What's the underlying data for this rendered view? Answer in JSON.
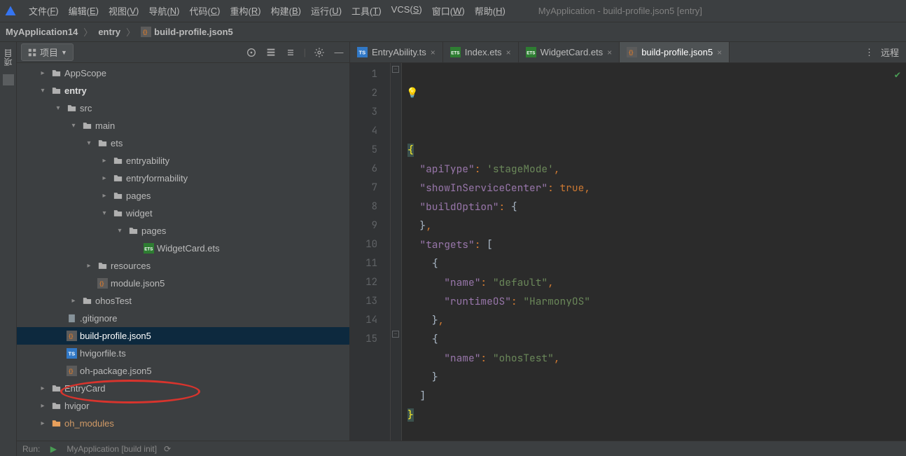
{
  "menubar": {
    "items": [
      {
        "label": "文件(F)"
      },
      {
        "label": "编辑(E)"
      },
      {
        "label": "视图(V)"
      },
      {
        "label": "导航(N)"
      },
      {
        "label": "代码(C)"
      },
      {
        "label": "重构(R)"
      },
      {
        "label": "构建(B)"
      },
      {
        "label": "运行(U)"
      },
      {
        "label": "工具(T)"
      },
      {
        "label": "VCS(S)"
      },
      {
        "label": "窗口(W)"
      },
      {
        "label": "帮助(H)"
      }
    ],
    "window_title": "MyApplication - build-profile.json5 [entry]"
  },
  "breadcrumbs": [
    {
      "label": "MyApplication14"
    },
    {
      "label": "entry"
    },
    {
      "label": "build-profile.json5",
      "icon": "json-file"
    }
  ],
  "left_strip": {
    "label": "项目"
  },
  "panel": {
    "dropdown_label": "项目",
    "tree": [
      {
        "depth": 0,
        "arrow": "right",
        "icon": "folder",
        "label": "AppScope"
      },
      {
        "depth": 0,
        "arrow": "down",
        "icon": "folder",
        "label": "entry",
        "bold": true
      },
      {
        "depth": 1,
        "arrow": "down",
        "icon": "folder",
        "label": "src"
      },
      {
        "depth": 2,
        "arrow": "down",
        "icon": "folder",
        "label": "main"
      },
      {
        "depth": 3,
        "arrow": "down",
        "icon": "folder",
        "label": "ets"
      },
      {
        "depth": 4,
        "arrow": "right",
        "icon": "folder",
        "label": "entryability"
      },
      {
        "depth": 4,
        "arrow": "right",
        "icon": "folder",
        "label": "entryformability"
      },
      {
        "depth": 4,
        "arrow": "right",
        "icon": "folder",
        "label": "pages"
      },
      {
        "depth": 4,
        "arrow": "down",
        "icon": "folder",
        "label": "widget"
      },
      {
        "depth": 5,
        "arrow": "down",
        "icon": "folder",
        "label": "pages"
      },
      {
        "depth": 6,
        "arrow": "",
        "icon": "ets-file",
        "label": "WidgetCard.ets"
      },
      {
        "depth": 3,
        "arrow": "right",
        "icon": "folder",
        "label": "resources"
      },
      {
        "depth": 3,
        "arrow": "",
        "icon": "json-file",
        "label": "module.json5"
      },
      {
        "depth": 2,
        "arrow": "right",
        "icon": "folder",
        "label": "ohosTest"
      },
      {
        "depth": 1,
        "arrow": "",
        "icon": "file",
        "label": ".gitignore"
      },
      {
        "depth": 1,
        "arrow": "",
        "icon": "json-file",
        "label": "build-profile.json5",
        "selected": true
      },
      {
        "depth": 1,
        "arrow": "",
        "icon": "ts-file",
        "label": "hvigorfile.ts"
      },
      {
        "depth": 1,
        "arrow": "",
        "icon": "json-file",
        "label": "oh-package.json5"
      },
      {
        "depth": 0,
        "arrow": "right",
        "icon": "folder",
        "label": "EntryCard"
      },
      {
        "depth": 0,
        "arrow": "right",
        "icon": "folder",
        "label": "hvigor"
      },
      {
        "depth": 0,
        "arrow": "right",
        "icon": "folder-highlight",
        "label": "oh_modules",
        "orange": true
      }
    ]
  },
  "tabs": [
    {
      "label": "EntryAbility.ts",
      "icon": "ts-file"
    },
    {
      "label": "Index.ets",
      "icon": "ets-file"
    },
    {
      "label": "WidgetCard.ets",
      "icon": "ets-file"
    },
    {
      "label": "build-profile.json5",
      "icon": "json-file",
      "active": true
    }
  ],
  "tab_right_label": "远程",
  "code": {
    "line_count": 15,
    "lines": [
      [
        {
          "t": "brace-hl",
          "v": "{"
        }
      ],
      [
        {
          "t": "sp",
          "v": "  "
        },
        {
          "t": "key",
          "v": "\"apiType\""
        },
        {
          "t": "punc",
          "v": ": "
        },
        {
          "t": "str",
          "v": "'stageMode'"
        },
        {
          "t": "punc",
          "v": ","
        }
      ],
      [
        {
          "t": "sp",
          "v": "  "
        },
        {
          "t": "key",
          "v": "\"showInServiceCenter\""
        },
        {
          "t": "punc",
          "v": ": "
        },
        {
          "t": "bool",
          "v": "true"
        },
        {
          "t": "punc",
          "v": ","
        }
      ],
      [
        {
          "t": "sp",
          "v": "  "
        },
        {
          "t": "key",
          "v": "\"buildOption\""
        },
        {
          "t": "punc",
          "v": ": "
        },
        {
          "t": "brace",
          "v": "{"
        }
      ],
      [
        {
          "t": "sp",
          "v": "  "
        },
        {
          "t": "brace",
          "v": "}"
        },
        {
          "t": "punc",
          "v": ","
        }
      ],
      [
        {
          "t": "sp",
          "v": "  "
        },
        {
          "t": "key",
          "v": "\"targets\""
        },
        {
          "t": "punc",
          "v": ": "
        },
        {
          "t": "brace",
          "v": "["
        }
      ],
      [
        {
          "t": "sp",
          "v": "    "
        },
        {
          "t": "brace",
          "v": "{"
        }
      ],
      [
        {
          "t": "sp",
          "v": "      "
        },
        {
          "t": "key",
          "v": "\"name\""
        },
        {
          "t": "punc",
          "v": ": "
        },
        {
          "t": "str",
          "v": "\"default\""
        },
        {
          "t": "punc",
          "v": ","
        }
      ],
      [
        {
          "t": "sp",
          "v": "      "
        },
        {
          "t": "key",
          "v": "\"runtimeOS\""
        },
        {
          "t": "punc",
          "v": ": "
        },
        {
          "t": "str",
          "v": "\"HarmonyOS\""
        }
      ],
      [
        {
          "t": "sp",
          "v": "    "
        },
        {
          "t": "brace",
          "v": "}"
        },
        {
          "t": "punc",
          "v": ","
        }
      ],
      [
        {
          "t": "sp",
          "v": "    "
        },
        {
          "t": "brace",
          "v": "{"
        }
      ],
      [
        {
          "t": "sp",
          "v": "      "
        },
        {
          "t": "key",
          "v": "\"name\""
        },
        {
          "t": "punc",
          "v": ": "
        },
        {
          "t": "str",
          "v": "\"ohosTest\""
        },
        {
          "t": "punc",
          "v": ","
        }
      ],
      [
        {
          "t": "sp",
          "v": "    "
        },
        {
          "t": "brace",
          "v": "}"
        }
      ],
      [
        {
          "t": "sp",
          "v": "  "
        },
        {
          "t": "brace",
          "v": "]"
        }
      ],
      [
        {
          "t": "brace-hl",
          "v": "}"
        }
      ]
    ]
  },
  "footer": {
    "run_label": "Run:",
    "run_config": "MyApplication [build init]"
  }
}
